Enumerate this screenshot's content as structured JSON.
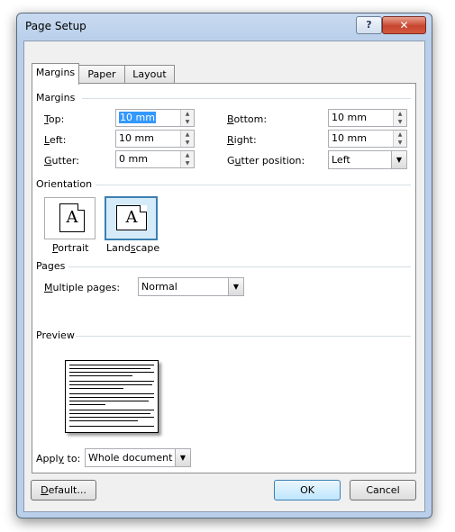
{
  "window": {
    "title": "Page Setup",
    "help_glyph": "?",
    "close_glyph": "✕"
  },
  "tabs": [
    "Margins",
    "Paper",
    "Layout"
  ],
  "margins": {
    "group_title": "Margins",
    "top_label_u": "T",
    "top_label_rest": "op:",
    "top_value": "10 mm",
    "bottom_label_u": "B",
    "bottom_label_rest": "ottom:",
    "bottom_value": "10 mm",
    "left_label_u": "L",
    "left_label_rest": "eft:",
    "left_value": "10 mm",
    "right_label_u": "R",
    "right_label_rest": "ight:",
    "right_value": "10 mm",
    "gutter_label_u": "G",
    "gutter_label_rest": "utter:",
    "gutter_value": "0 mm",
    "gutter_pos_label_a": "G",
    "gutter_pos_label_u": "u",
    "gutter_pos_label_rest": "tter position:",
    "gutter_pos_value": "Left"
  },
  "orientation": {
    "group_title": "Orientation",
    "portrait_u": "P",
    "portrait_rest": "ortrait",
    "landscape_a": "Land",
    "landscape_u": "s",
    "landscape_rest": "cape",
    "glyph": "A",
    "selected": "landscape"
  },
  "pages": {
    "group_title": "Pages",
    "multiple_u": "M",
    "multiple_rest": "ultiple pages:",
    "multiple_value": "Normal"
  },
  "preview": {
    "group_title": "Preview"
  },
  "apply": {
    "label_a": "Appl",
    "label_u": "y",
    "label_rest": " to:",
    "value": "Whole document"
  },
  "buttons": {
    "default_u": "D",
    "default_rest": "efault...",
    "ok": "OK",
    "cancel": "Cancel"
  },
  "icons": {
    "spin_up": "▲",
    "spin_down": "▼",
    "dropdown": "▼"
  }
}
